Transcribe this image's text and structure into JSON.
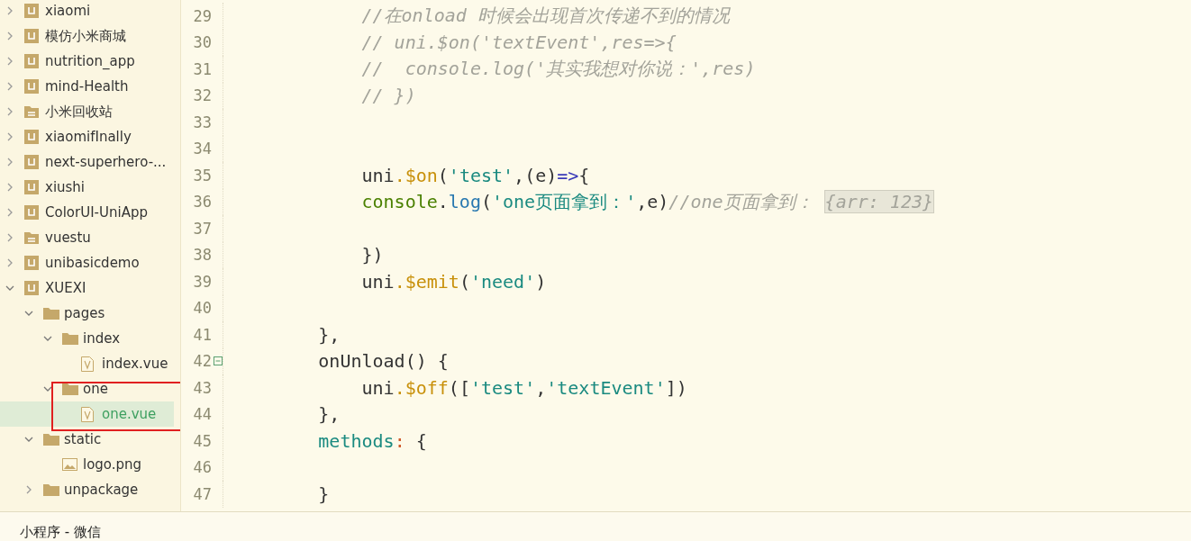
{
  "project_tree": [
    {
      "label": "xiaomi",
      "kind": "project",
      "expanded": false,
      "selected": false
    },
    {
      "label": "模仿小米商城",
      "kind": "project",
      "expanded": false,
      "selected": false
    },
    {
      "label": "nutrition_app",
      "kind": "project",
      "expanded": false,
      "selected": false
    },
    {
      "label": "mind-Health",
      "kind": "project",
      "expanded": false,
      "selected": false
    },
    {
      "label": "小米回收站",
      "kind": "directory",
      "expanded": false,
      "selected": false
    },
    {
      "label": "xiaomifInally",
      "kind": "project",
      "expanded": false,
      "selected": false
    },
    {
      "label": "next-superhero-...",
      "kind": "project",
      "expanded": false,
      "selected": false
    },
    {
      "label": "xiushi",
      "kind": "project",
      "expanded": false,
      "selected": false
    },
    {
      "label": "ColorUI-UniApp",
      "kind": "project",
      "expanded": false,
      "selected": false
    },
    {
      "label": "vuestu",
      "kind": "directory",
      "expanded": false,
      "selected": false
    },
    {
      "label": "unibasicdemo",
      "kind": "project",
      "expanded": false,
      "selected": false
    },
    {
      "label": "XUEXI",
      "kind": "project",
      "expanded": true,
      "selected": false,
      "children": [
        {
          "label": "pages",
          "kind": "folder",
          "expanded": true,
          "selected": false,
          "children": [
            {
              "label": "index",
              "kind": "folder",
              "expanded": true,
              "selected": false,
              "children": [
                {
                  "label": "index.vue",
                  "kind": "vue",
                  "selected": false
                }
              ]
            },
            {
              "label": "one",
              "kind": "folder",
              "expanded": true,
              "selected": false,
              "children": [
                {
                  "label": "one.vue",
                  "kind": "vue",
                  "selected": true
                }
              ]
            }
          ]
        },
        {
          "label": "static",
          "kind": "folder",
          "expanded": true,
          "selected": false,
          "children": [
            {
              "label": "logo.png",
              "kind": "image",
              "selected": false
            }
          ]
        },
        {
          "label": "unpackage",
          "kind": "folder",
          "expanded": false,
          "selected": false
        }
      ]
    }
  ],
  "editor": {
    "lines": [
      {
        "number": "29",
        "tokens": [
          {
            "kind": "comment",
            "text": "            //在onload 时候会出现首次传递不到的情况"
          }
        ]
      },
      {
        "number": "30",
        "tokens": [
          {
            "kind": "comment",
            "text": "            // uni.$on('textEvent',res=>{"
          }
        ]
      },
      {
        "number": "31",
        "tokens": [
          {
            "kind": "comment",
            "text": "            //  console.log('其实我想对你说：',res)"
          }
        ]
      },
      {
        "number": "32",
        "tokens": [
          {
            "kind": "comment",
            "text": "            // })"
          }
        ]
      },
      {
        "number": "33"
      },
      {
        "number": "34"
      },
      {
        "number": "35",
        "tokens": [
          {
            "kind": "plain",
            "text": "            uni"
          },
          {
            "kind": "method",
            "text": ".$on"
          },
          {
            "kind": "plain",
            "text": "("
          },
          {
            "kind": "string",
            "text": "'test'"
          },
          {
            "kind": "plain",
            "text": ",(e)"
          },
          {
            "kind": "arrow",
            "text": "=>"
          },
          {
            "kind": "plain",
            "text": "{"
          }
        ]
      },
      {
        "number": "36",
        "tokens": [
          {
            "kind": "console",
            "text": "            console"
          },
          {
            "kind": "plain",
            "text": "."
          },
          {
            "kind": "func",
            "text": "log"
          },
          {
            "kind": "plain",
            "text": "("
          },
          {
            "kind": "string",
            "text": "'one页面拿到：'"
          },
          {
            "kind": "plain",
            "text": ",e)"
          },
          {
            "kind": "comment",
            "text": "//one页面拿到： "
          },
          {
            "kind": "hint",
            "text": "{arr: 123}"
          }
        ]
      },
      {
        "number": "37"
      },
      {
        "number": "38",
        "tokens": [
          {
            "kind": "plain",
            "text": "            })"
          }
        ]
      },
      {
        "number": "39",
        "tokens": [
          {
            "kind": "plain",
            "text": "            uni"
          },
          {
            "kind": "method",
            "text": ".$emit"
          },
          {
            "kind": "plain",
            "text": "("
          },
          {
            "kind": "string",
            "text": "'need'"
          },
          {
            "kind": "plain",
            "text": ")"
          }
        ]
      },
      {
        "number": "40"
      },
      {
        "number": "41",
        "tokens": [
          {
            "kind": "plain",
            "text": "        },"
          }
        ]
      },
      {
        "number": "42",
        "fold_open": true,
        "tokens": [
          {
            "kind": "plain",
            "text": "        onUnload() {"
          }
        ]
      },
      {
        "number": "43",
        "tokens": [
          {
            "kind": "plain",
            "text": "            uni"
          },
          {
            "kind": "method",
            "text": ".$off"
          },
          {
            "kind": "plain",
            "text": "(["
          },
          {
            "kind": "string",
            "text": "'test'"
          },
          {
            "kind": "plain",
            "text": ","
          },
          {
            "kind": "string",
            "text": "'textEvent'"
          },
          {
            "kind": "plain",
            "text": "])"
          }
        ]
      },
      {
        "number": "44",
        "tokens": [
          {
            "kind": "plain",
            "text": "        },"
          }
        ]
      },
      {
        "number": "45",
        "tokens": [
          {
            "kind": "property",
            "text": "        methods"
          },
          {
            "kind": "colon",
            "text": ":"
          },
          {
            "kind": "plain",
            "text": " {"
          }
        ]
      },
      {
        "number": "46"
      },
      {
        "number": "47",
        "tokens": [
          {
            "kind": "plain",
            "text": "        }"
          }
        ]
      }
    ]
  },
  "bottom_panel": {
    "title": "小程序 - 微信"
  }
}
